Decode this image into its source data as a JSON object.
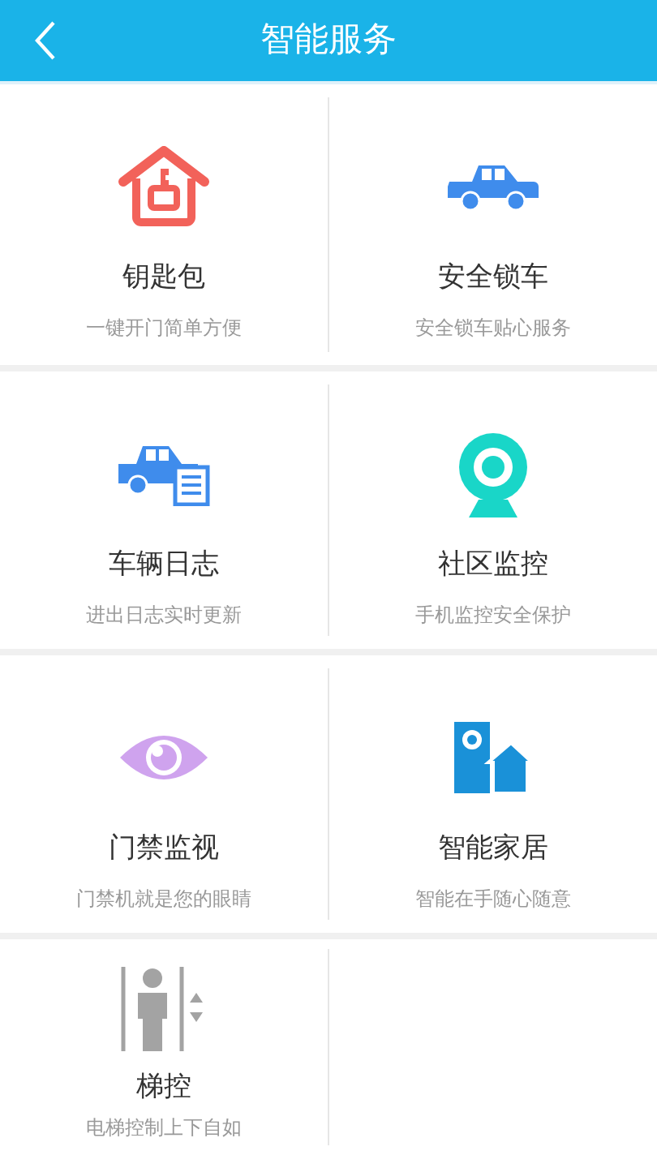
{
  "header": {
    "title": "智能服务"
  },
  "services": [
    {
      "title": "钥匙包",
      "subtitle": "一键开门简单方便"
    },
    {
      "title": "安全锁车",
      "subtitle": "安全锁车贴心服务"
    },
    {
      "title": "车辆日志",
      "subtitle": "进出日志实时更新"
    },
    {
      "title": "社区监控",
      "subtitle": "手机监控安全保护"
    },
    {
      "title": "门禁监视",
      "subtitle": "门禁机就是您的眼睛"
    },
    {
      "title": "智能家居",
      "subtitle": "智能在手随心随意"
    },
    {
      "title": "梯控",
      "subtitle": "电梯控制上下自如"
    }
  ]
}
